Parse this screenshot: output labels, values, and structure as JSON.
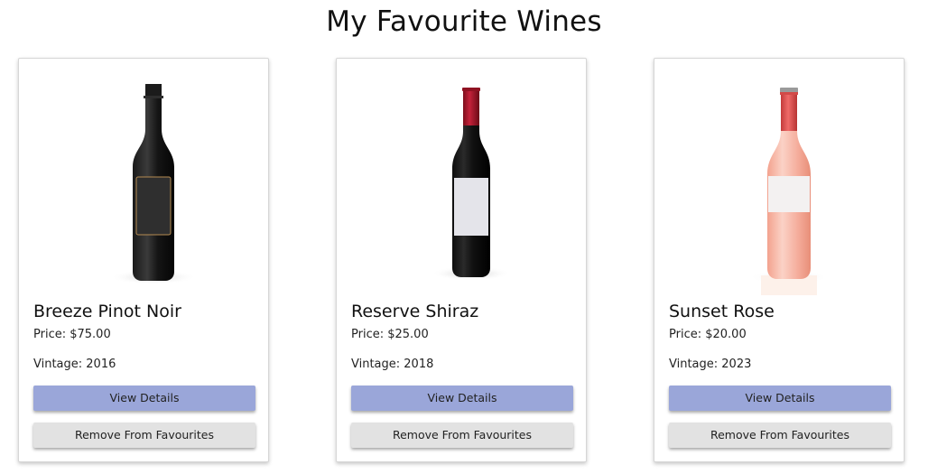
{
  "page": {
    "title": "My Favourite Wines"
  },
  "wines": [
    {
      "name": "Breeze Pinot Noir",
      "price": "Price: $75.00",
      "vintage": "Vintage: 2016",
      "view_label": "View Details",
      "remove_label": "Remove From Favourites",
      "image_icon": "dark-wine-bottle-image"
    },
    {
      "name": "Reserve Shiraz",
      "price": "Price: $25.00",
      "vintage": "Vintage: 2018",
      "view_label": "View Details",
      "remove_label": "Remove From Favourites",
      "image_icon": "red-wine-bottle-image"
    },
    {
      "name": "Sunset Rose",
      "price": "Price: $20.00",
      "vintage": "Vintage: 2023",
      "view_label": "View Details",
      "remove_label": "Remove From Favourites",
      "image_icon": "rose-wine-bottle-image"
    }
  ],
  "colors": {
    "view_button": "#9aa6d9",
    "remove_button": "#e2e2e2",
    "card_border": "#d6d6d6"
  }
}
